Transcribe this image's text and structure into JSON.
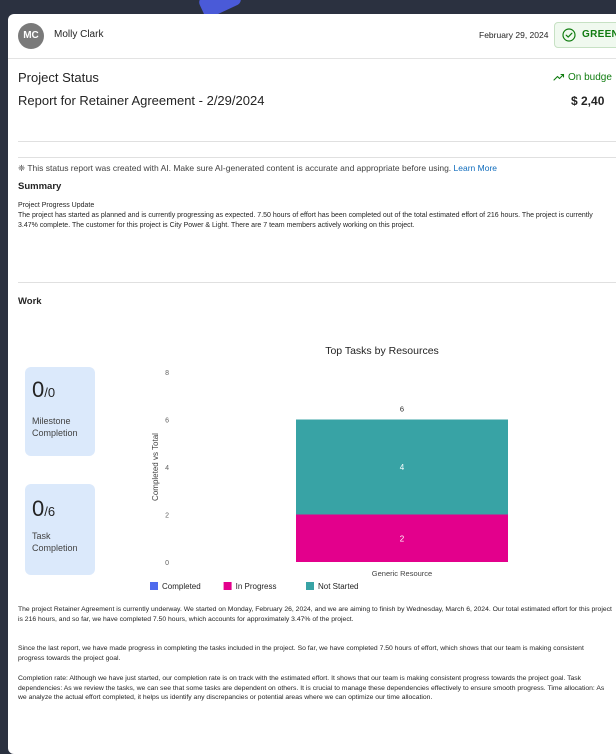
{
  "header": {
    "avatar_initials": "MC",
    "user_name": "Molly Clark",
    "date": "February 29, 2024",
    "status": "GREEN"
  },
  "title": {
    "project_status": "Project Status",
    "report_title": "Report for Retainer Agreement - 2/29/2024",
    "budget_label": "On budge",
    "budget_value": "$ 2,40"
  },
  "ai_notice": {
    "text": "This status report was created with AI. Make sure AI-generated content is accurate and appropriate before using.",
    "link": "Learn More"
  },
  "summary": {
    "heading": "Summary",
    "subheading": "Project Progress Update",
    "body": "The project has started as planned and is currently progressing as expected. 7.50 hours of effort has been completed out of the total estimated effort of 216 hours. The project is currently 3.47% complete. The customer for this project is City Power & Light. There are 7 team members actively working on this project."
  },
  "work": {
    "heading": "Work",
    "milestone": {
      "value": "0",
      "denominator": "/0",
      "label_line1": "Milestone",
      "label_line2": "Completion"
    },
    "task": {
      "value": "0",
      "denominator": "/6",
      "label_line1": "Task",
      "label_line2": "Completion"
    }
  },
  "chart_data": {
    "type": "bar",
    "stacked": true,
    "title": "Top Tasks by Resources",
    "ylabel": "Completed vs Total",
    "xlabel": "",
    "ylim": [
      0,
      8
    ],
    "yticks": [
      "0",
      "2",
      "4",
      "6",
      "8"
    ],
    "categories": [
      "Generic Resource"
    ],
    "series": [
      {
        "name": "Completed",
        "values": [
          0
        ],
        "color": "#4f6bed"
      },
      {
        "name": "In Progress",
        "values": [
          2
        ],
        "color": "#e3008c"
      },
      {
        "name": "Not Started",
        "values": [
          4
        ],
        "color": "#38a3a5"
      }
    ],
    "total_labels": [
      "6"
    ],
    "legend_position": "bottom-left",
    "grid": false
  },
  "paragraphs": [
    "The project Retainer Agreement is currently underway. We started on Monday, February 26, 2024, and we are aiming to finish by Wednesday, March 6, 2024. Our total estimated effort for this project is 216 hours, and so far, we have completed 7.50 hours, which accounts for approximately 3.47% of the project.",
    "Since the last report, we have made progress in completing the tasks included in the project. So far, we have completed 7.50 hours of effort, which shows that our team is making consistent progress towards the project goal.",
    "Completion rate: Although we have just started, our completion rate is on track with the estimated effort. It shows that our team is making consistent progress towards the project goal. Task dependencies: As we review the tasks, we can see that some tasks are dependent on others. It is crucial to manage these dependencies effectively to ensure smooth progress. Time allocation: As we analyze the actual effort completed, it helps us identify any discrepancies or potential areas where we can optimize our time allocation."
  ]
}
